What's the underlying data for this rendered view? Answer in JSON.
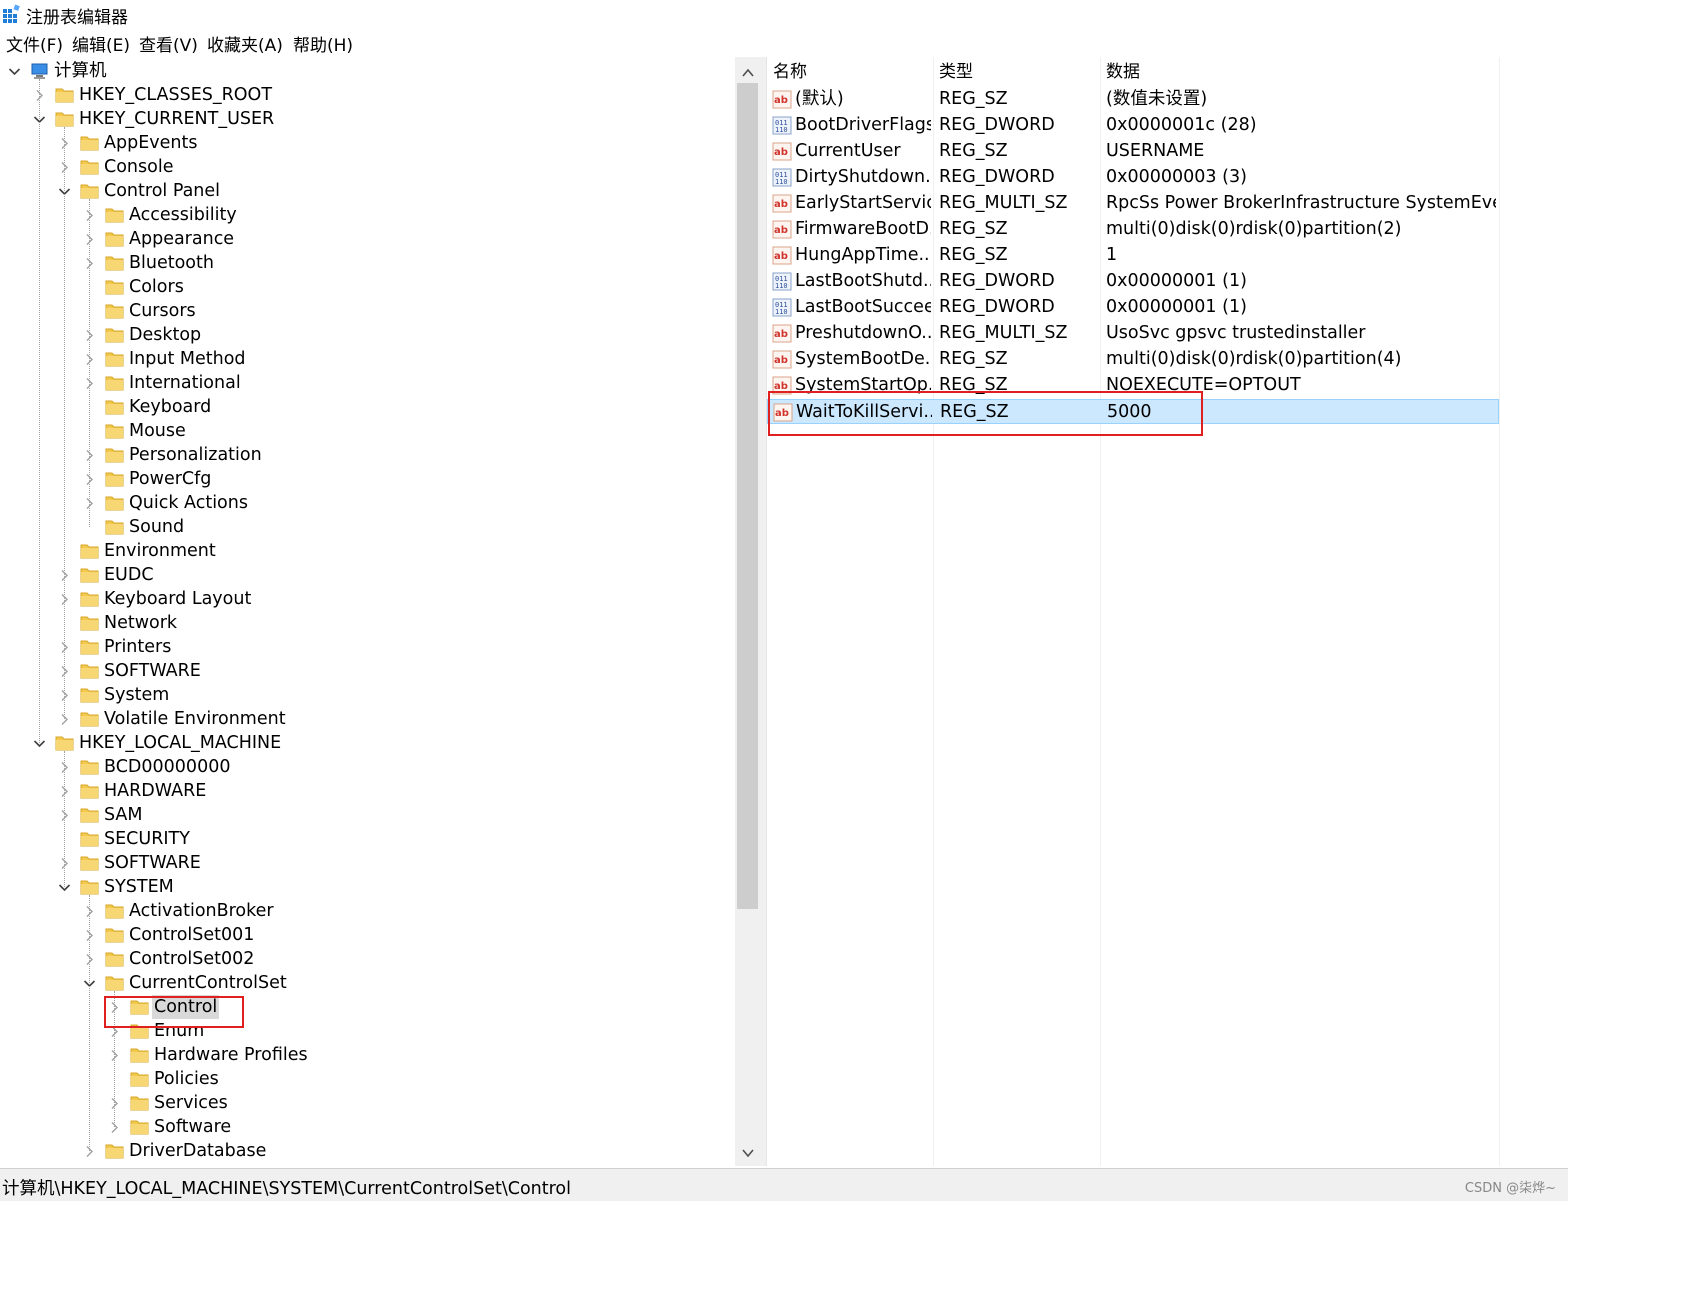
{
  "window": {
    "title": "注册表编辑器",
    "icon": "regedit-icon"
  },
  "menu": [
    "文件(F)",
    "编辑(E)",
    "查看(V)",
    "收藏夹(A)",
    "帮助(H)"
  ],
  "tree": {
    "nodes": [
      {
        "label": "计算机",
        "depth": 0,
        "state": "expanded",
        "icon": "computer-icon"
      },
      {
        "label": "HKEY_CLASSES_ROOT",
        "depth": 1,
        "state": "collapsed"
      },
      {
        "label": "HKEY_CURRENT_USER",
        "depth": 1,
        "state": "expanded"
      },
      {
        "label": "AppEvents",
        "depth": 2,
        "state": "collapsed"
      },
      {
        "label": "Console",
        "depth": 2,
        "state": "collapsed"
      },
      {
        "label": "Control Panel",
        "depth": 2,
        "state": "expanded"
      },
      {
        "label": "Accessibility",
        "depth": 3,
        "state": "collapsed"
      },
      {
        "label": "Appearance",
        "depth": 3,
        "state": "collapsed"
      },
      {
        "label": "Bluetooth",
        "depth": 3,
        "state": "collapsed"
      },
      {
        "label": "Colors",
        "depth": 3,
        "state": "leaf"
      },
      {
        "label": "Cursors",
        "depth": 3,
        "state": "leaf"
      },
      {
        "label": "Desktop",
        "depth": 3,
        "state": "collapsed"
      },
      {
        "label": "Input Method",
        "depth": 3,
        "state": "collapsed"
      },
      {
        "label": "International",
        "depth": 3,
        "state": "collapsed"
      },
      {
        "label": "Keyboard",
        "depth": 3,
        "state": "leaf"
      },
      {
        "label": "Mouse",
        "depth": 3,
        "state": "leaf"
      },
      {
        "label": "Personalization",
        "depth": 3,
        "state": "collapsed"
      },
      {
        "label": "PowerCfg",
        "depth": 3,
        "state": "collapsed"
      },
      {
        "label": "Quick Actions",
        "depth": 3,
        "state": "collapsed"
      },
      {
        "label": "Sound",
        "depth": 3,
        "state": "leaf"
      },
      {
        "label": "Environment",
        "depth": 2,
        "state": "leaf"
      },
      {
        "label": "EUDC",
        "depth": 2,
        "state": "collapsed"
      },
      {
        "label": "Keyboard Layout",
        "depth": 2,
        "state": "collapsed"
      },
      {
        "label": "Network",
        "depth": 2,
        "state": "leaf"
      },
      {
        "label": "Printers",
        "depth": 2,
        "state": "collapsed"
      },
      {
        "label": "SOFTWARE",
        "depth": 2,
        "state": "collapsed"
      },
      {
        "label": "System",
        "depth": 2,
        "state": "collapsed"
      },
      {
        "label": "Volatile Environment",
        "depth": 2,
        "state": "collapsed"
      },
      {
        "label": "HKEY_LOCAL_MACHINE",
        "depth": 1,
        "state": "expanded"
      },
      {
        "label": "BCD00000000",
        "depth": 2,
        "state": "collapsed"
      },
      {
        "label": "HARDWARE",
        "depth": 2,
        "state": "collapsed"
      },
      {
        "label": "SAM",
        "depth": 2,
        "state": "collapsed"
      },
      {
        "label": "SECURITY",
        "depth": 2,
        "state": "leaf"
      },
      {
        "label": "SOFTWARE",
        "depth": 2,
        "state": "collapsed"
      },
      {
        "label": "SYSTEM",
        "depth": 2,
        "state": "expanded"
      },
      {
        "label": "ActivationBroker",
        "depth": 3,
        "state": "collapsed"
      },
      {
        "label": "ControlSet001",
        "depth": 3,
        "state": "collapsed"
      },
      {
        "label": "ControlSet002",
        "depth": 3,
        "state": "collapsed"
      },
      {
        "label": "CurrentControlSet",
        "depth": 3,
        "state": "expanded"
      },
      {
        "label": "Control",
        "depth": 4,
        "state": "collapsed",
        "selected": true
      },
      {
        "label": "Enum",
        "depth": 4,
        "state": "collapsed"
      },
      {
        "label": "Hardware Profiles",
        "depth": 4,
        "state": "collapsed"
      },
      {
        "label": "Policies",
        "depth": 4,
        "state": "leaf"
      },
      {
        "label": "Services",
        "depth": 4,
        "state": "collapsed"
      },
      {
        "label": "Software",
        "depth": 4,
        "state": "collapsed"
      },
      {
        "label": "DriverDatabase",
        "depth": 3,
        "state": "collapsed"
      }
    ]
  },
  "list": {
    "headers": {
      "name": "名称",
      "type": "类型",
      "data": "数据"
    },
    "rows": [
      {
        "name": "(默认)",
        "type": "REG_SZ",
        "data": "(数值未设置)",
        "icon": "string-value-icon"
      },
      {
        "name": "BootDriverFlags",
        "type": "REG_DWORD",
        "data": "0x0000001c (28)",
        "icon": "binary-value-icon"
      },
      {
        "name": "CurrentUser",
        "type": "REG_SZ",
        "data": "USERNAME",
        "icon": "string-value-icon"
      },
      {
        "name": "DirtyShutdown...",
        "type": "REG_DWORD",
        "data": "0x00000003 (3)",
        "icon": "binary-value-icon"
      },
      {
        "name": "EarlyStartServic...",
        "type": "REG_MULTI_SZ",
        "data": "RpcSs Power BrokerInfrastructure SystemEvent...",
        "icon": "string-value-icon"
      },
      {
        "name": "FirmwareBootD...",
        "type": "REG_SZ",
        "data": "multi(0)disk(0)rdisk(0)partition(2)",
        "icon": "string-value-icon"
      },
      {
        "name": "HungAppTime...",
        "type": "REG_SZ",
        "data": "1",
        "icon": "string-value-icon"
      },
      {
        "name": "LastBootShutd...",
        "type": "REG_DWORD",
        "data": "0x00000001 (1)",
        "icon": "binary-value-icon"
      },
      {
        "name": "LastBootSuccee...",
        "type": "REG_DWORD",
        "data": "0x00000001 (1)",
        "icon": "binary-value-icon"
      },
      {
        "name": "PreshutdownO...",
        "type": "REG_MULTI_SZ",
        "data": "UsoSvc gpsvc trustedinstaller",
        "icon": "string-value-icon"
      },
      {
        "name": "SystemBootDe...",
        "type": "REG_SZ",
        "data": "multi(0)disk(0)rdisk(0)partition(4)",
        "icon": "string-value-icon"
      },
      {
        "name": "SystemStartOp...",
        "type": "REG_SZ",
        "data": " NOEXECUTE=OPTOUT",
        "icon": "string-value-icon"
      },
      {
        "name": "WaitToKillServi...",
        "type": "REG_SZ",
        "data": "5000",
        "icon": "string-value-icon",
        "selected": true
      }
    ]
  },
  "statusbar": {
    "path": "计算机\\HKEY_LOCAL_MACHINE\\SYSTEM\\CurrentControlSet\\Control"
  },
  "watermark": "CSDN @柒烨~",
  "colors": {
    "selection_bg": "#cce8ff",
    "selection_border": "#99d1ff",
    "annotation_red": "#e02020",
    "folder_yellow": "#f2c94c",
    "tree_selected_bg": "#d9d9d9"
  }
}
